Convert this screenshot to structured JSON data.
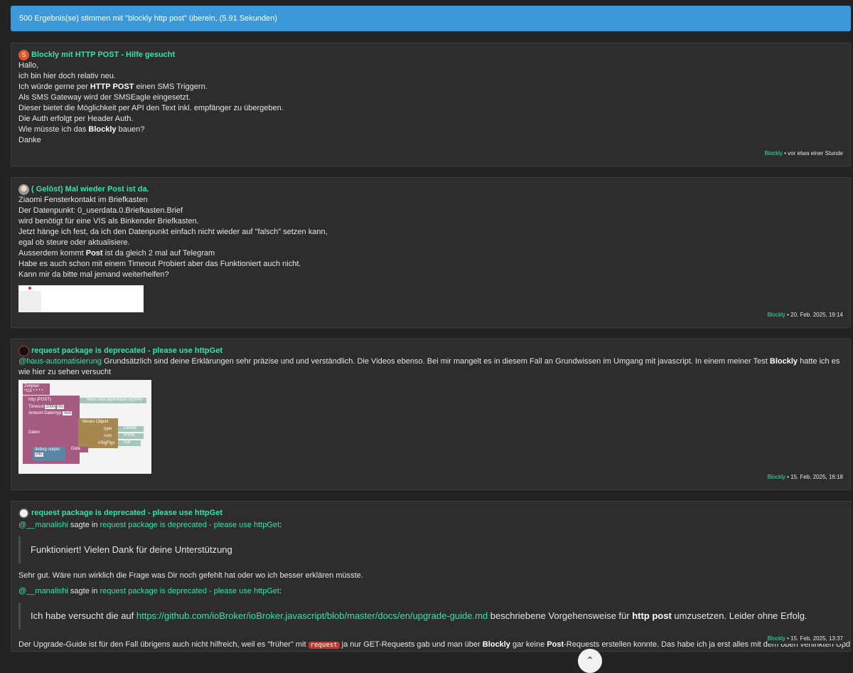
{
  "banner": {
    "text": "500 Ergebnis(se) stimmen mit \"blockly http post\" überein, (5.91 Sekunden)"
  },
  "posts": [
    {
      "title": "Blockly mit HTTP POST - Hilfe gesucht",
      "avatar_letter": "S",
      "lines": [
        "Hallo,",
        "ich bin hier doch relativ neu.",
        "Ich würde gerne per ",
        "HTTP POST",
        " einen SMS Triggern.",
        "Als SMS Gateway wird der SMSEagle eingesetzt.",
        "Dieser bietet die Möglichkeit per API den Text inkl. empfänger zu übergeben.",
        "Die Auth erfolgt per Header Auth.",
        "Wie müsste ich das ",
        "Blockly",
        " bauen?",
        "Danke"
      ],
      "category": "Blockly",
      "time": " • vor etwa einer Stunde"
    },
    {
      "title": "( Gelöst) Mal wieder Post ist da.",
      "lines": [
        "Ziaomi Fensterkontakt im Briefkasten",
        "Der Datenpunkt: 0_userdata.0.Briefkasten.Brief",
        "wird benötigt für eine VIS als Binkender Briefkasten.",
        "Jetzt hänge ich fest, da ich den Datenpunkt einfach nicht wieder auf \"falsch\" setzen kann,",
        "egal ob steure oder aktualisiere.",
        "Ausserdem kommt ",
        "Post",
        " ist da gleich 2 mal auf Telegram",
        "Habe es auch schon mit einem Timeout Probiert aber das Funktioniert auch nicht.",
        "Kann mir da bitte mal jemand weiterhelfen?"
      ],
      "category": "Blockly",
      "time": " • 20. Feb. 2025, 19:14"
    },
    {
      "title": "request package is deprecated - please use httpGet",
      "mention": "@haus-automatisierung",
      "text_a": " Grundsätzlich sind deine Erklärungen sehr präzise und und verständlich. Die Videos ebenso. Bei mir mangelt es in diesem Fall an Grundwissen im Umgang mit javascript. In einem meiner Test ",
      "text_b": "Blockly",
      "text_c": " hatte ich es wie hier zu sehen versucht",
      "blocks": {
        "zeitplan": "Zeitplan",
        "cron": "*/15 * * * *",
        "http": "http (POST)",
        "url": "https://api.hyperliquid.xyz/info",
        "timeout": "Timeout",
        "timeout_val": "2000",
        "ms": "ms",
        "antwort": "Antwort-Datentyp",
        "text": "Text",
        "daten": "Daten",
        "neues_objekt": "Neues Objekt",
        "type": "type",
        "l2book": "l2Book",
        "coin": "coin",
        "hype": "HYPE",
        "nsigfigs": "nSigFigs",
        "null": "null",
        "debug": "debug output",
        "data": "Data",
        "info": "info"
      },
      "category": "Blockly",
      "time": " • 15. Feb. 2025, 16:18"
    },
    {
      "title": "request package is deprecated - please use httpGet",
      "mention": "@__manalishi",
      "sagte": " sagte in ",
      "ref": "request package is deprecated - please use httpGet",
      "colon": ":",
      "quote1": "Funktioniert! Vielen Dank für deine Unterstützung",
      "reply": "Sehr gut. Wäre nun wirklich die Frage was Dir noch gefehlt hat oder wo ich besser erklären müsste.",
      "quote2_a": "Ich habe versucht die auf ",
      "quote2_link": "https://github.com/ioBroker/ioBroker.javascript/blob/master/docs/en/upgrade-guide.md",
      "quote2_b": " beschriebene Vorgehensweise für ",
      "quote2_bold": "http post",
      "quote2_c": " umzusetzen. Leider ohne Erfolg.",
      "last_a": "Der Upgrade-Guide ist für den Fall übrigens auch nicht hilfreich, weil es \"früher\" mit ",
      "last_tag": "request",
      "last_b": " ja nur GET-Requests gab und man über ",
      "last_bold1": "Blockly",
      "last_c": " gar keine ",
      "last_bold2": "Post",
      "last_d": "-Requests erstellen konnte. Das habe ich ja erst alles mit dem oben verlinkten Update dazu",
      "category": "Blockly",
      "time": " • 15. Feb. 2025, 13:37"
    }
  ],
  "scroll_top": {
    "icon": "chevron-up-icon"
  },
  "colors": {
    "accent": "#2ee6a6",
    "banner": "#3b99d9",
    "bg": "#232323",
    "card": "#2d2d2d"
  }
}
